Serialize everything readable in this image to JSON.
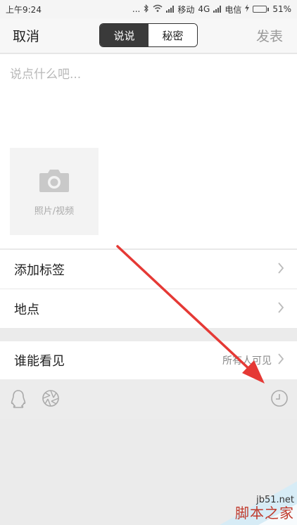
{
  "status_bar": {
    "time": "上午9:24",
    "dots": "...",
    "carrier1": "移动",
    "network": "4G",
    "carrier2": "电信",
    "battery_percent": "51%",
    "battery_level": 0.51
  },
  "header": {
    "cancel_label": "取消",
    "tabs": [
      {
        "label": "说说",
        "active": true
      },
      {
        "label": "秘密",
        "active": false
      }
    ],
    "publish_label": "发表"
  },
  "compose": {
    "placeholder": "说点什么吧...",
    "value": "",
    "photo_label": "照片/视频"
  },
  "rows": {
    "add_tag": "添加标签",
    "location": "地点",
    "visibility_label": "谁能看见",
    "visibility_value": "所有人可见"
  },
  "toolbar": {
    "icons": [
      "qq-icon",
      "aperture-icon",
      "clock-icon"
    ]
  },
  "annotation": {
    "arrow_color": "#e53935"
  },
  "watermark": {
    "site": "jb51.net",
    "name": "脚本之家"
  }
}
